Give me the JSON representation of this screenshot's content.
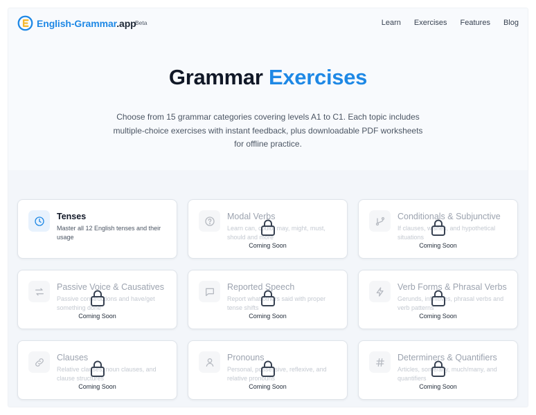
{
  "header": {
    "brand": "English-Grammar",
    "brand_suffix": ".app",
    "badge": "Beta",
    "nav": [
      "Learn",
      "Exercises",
      "Features",
      "Blog"
    ]
  },
  "hero": {
    "title_main": "Grammar",
    "title_accent": "Exercises",
    "description": "Choose from 15 grammar categories covering levels A1 to C1. Each topic includes multiple-choice exercises with instant feedback, plus downloadable PDF worksheets for offline practice."
  },
  "coming_soon_label": "Coming Soon",
  "categories": [
    {
      "title": "Tenses",
      "description": "Master all 12 English tenses and their usage",
      "icon": "clock-icon",
      "locked": false
    },
    {
      "title": "Modal Verbs",
      "description": "Learn can, could, may, might, must, should and more",
      "icon": "question-circle-icon",
      "locked": true
    },
    {
      "title": "Conditionals & Subjunctive",
      "description": "If clauses, wishes, and hypothetical situations",
      "icon": "branch-icon",
      "locked": true
    },
    {
      "title": "Passive Voice & Causatives",
      "description": "Passive constructions and have/get something done",
      "icon": "swap-arrows-icon",
      "locked": true
    },
    {
      "title": "Reported Speech",
      "description": "Report what others said with proper tense shifts",
      "icon": "speech-bubble-icon",
      "locked": true
    },
    {
      "title": "Verb Forms & Phrasal Verbs",
      "description": "Gerunds, infinitives, phrasal verbs and verb patterns",
      "icon": "lightning-icon",
      "locked": true
    },
    {
      "title": "Clauses",
      "description": "Relative clauses, noun clauses, and clause structures",
      "icon": "link-icon",
      "locked": true
    },
    {
      "title": "Pronouns",
      "description": "Personal, possessive, reflexive, and relative pronouns",
      "icon": "person-icon",
      "locked": true
    },
    {
      "title": "Determiners & Quantifiers",
      "description": "Articles, some/any, much/many, and quantifiers",
      "icon": "hash-icon",
      "locked": true
    }
  ],
  "colors": {
    "accent": "#1e88e5",
    "logo_yellow": "#f5b82e"
  }
}
